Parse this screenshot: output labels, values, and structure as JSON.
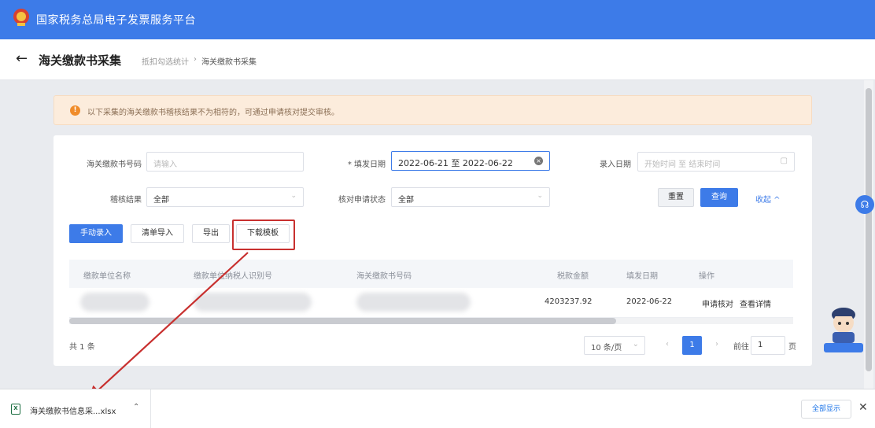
{
  "app": {
    "title": "国家税务总局电子发票服务平台"
  },
  "header": {
    "back_icon": "←",
    "title": "海关缴款书采集",
    "breadcrumbs": [
      "抵扣勾选统计",
      "›",
      "海关缴款书采集"
    ]
  },
  "notice": {
    "icon": "!",
    "text": "以下采集的海关缴款书稽核结果不为相符的，可通过申请核对提交审核。"
  },
  "filters": {
    "payment_no_label": "海关缴款书号码",
    "payment_no_placeholder": "请输入",
    "issue_date_label": "* 填发日期",
    "issue_date_value": "2022-06-21 至 2022-06-22",
    "entry_date_label": "录入日期",
    "entry_date_placeholder": "开始时间 至 结束时间",
    "check_result_label": "稽核结果",
    "check_result_value": "全部",
    "verify_status_label": "核对申请状态",
    "verify_status_value": "全部",
    "reset_label": "重置",
    "query_label": "查询",
    "collapse_label": "收起 ^"
  },
  "actions": {
    "manual_entry": "手动录入",
    "list_import": "清单导入",
    "export": "导出",
    "download_template": "下载模板"
  },
  "table": {
    "columns": [
      "缴款单位名称",
      "缴款单位纳税人识别号",
      "海关缴款书号码",
      "税款金额",
      "填发日期",
      "操作"
    ],
    "row": {
      "amount": "4203237.92",
      "date": "2022-06-22",
      "op_verify": "申请核对",
      "op_detail": "查看详情"
    }
  },
  "pager": {
    "total": "共 1 条",
    "page_size": "10 条/页",
    "current_page": "1",
    "goto_prefix": "前往",
    "goto_value": "1",
    "goto_suffix": "页"
  },
  "download_bar": {
    "file_name": "海关缴款书信息采...xlsx",
    "show_all": "全部显示"
  },
  "colors": {
    "primary": "#3d7be8",
    "notice_bg": "#fcecdc",
    "highlight": "#c8302f"
  }
}
